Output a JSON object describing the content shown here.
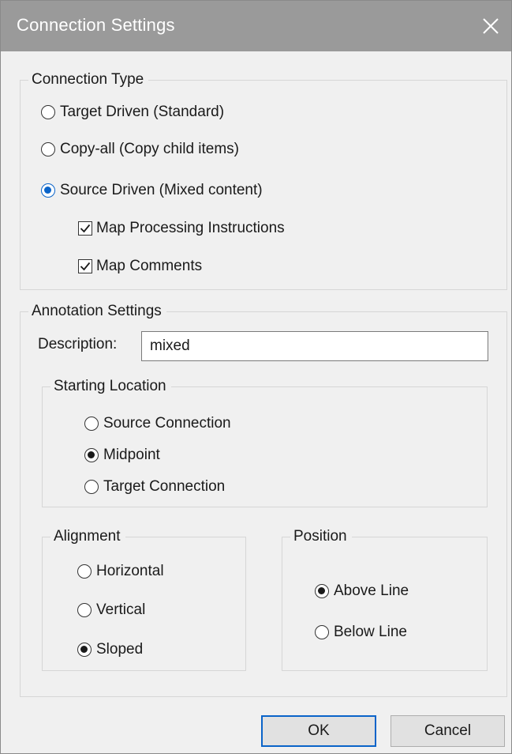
{
  "window": {
    "title": "Connection Settings",
    "close_icon": "close-icon"
  },
  "connection_type": {
    "legend": "Connection Type",
    "options": [
      {
        "label": "Target Driven (Standard)",
        "selected": false
      },
      {
        "label": "Copy-all (Copy child items)",
        "selected": false
      },
      {
        "label": "Source Driven (Mixed content)",
        "selected": true
      }
    ],
    "checkboxes": [
      {
        "label": "Map Processing Instructions",
        "checked": true
      },
      {
        "label": "Map Comments",
        "checked": true
      }
    ]
  },
  "annotation": {
    "legend": "Annotation Settings",
    "description_label": "Description:",
    "description_value": "mixed",
    "starting_location": {
      "legend": "Starting Location",
      "options": [
        {
          "label": "Source Connection",
          "selected": false
        },
        {
          "label": "Midpoint",
          "selected": true
        },
        {
          "label": "Target Connection",
          "selected": false
        }
      ]
    },
    "alignment": {
      "legend": "Alignment",
      "options": [
        {
          "label": "Horizontal",
          "selected": false
        },
        {
          "label": "Vertical",
          "selected": false
        },
        {
          "label": "Sloped",
          "selected": true
        }
      ]
    },
    "position": {
      "legend": "Position",
      "options": [
        {
          "label": "Above Line",
          "selected": true
        },
        {
          "label": "Below Line",
          "selected": false
        }
      ]
    }
  },
  "buttons": {
    "ok": "OK",
    "cancel": "Cancel"
  },
  "colors": {
    "accent": "#0a64c9",
    "titlebar": "#9a9a9a",
    "dialog_bg": "#f0f0f0"
  }
}
